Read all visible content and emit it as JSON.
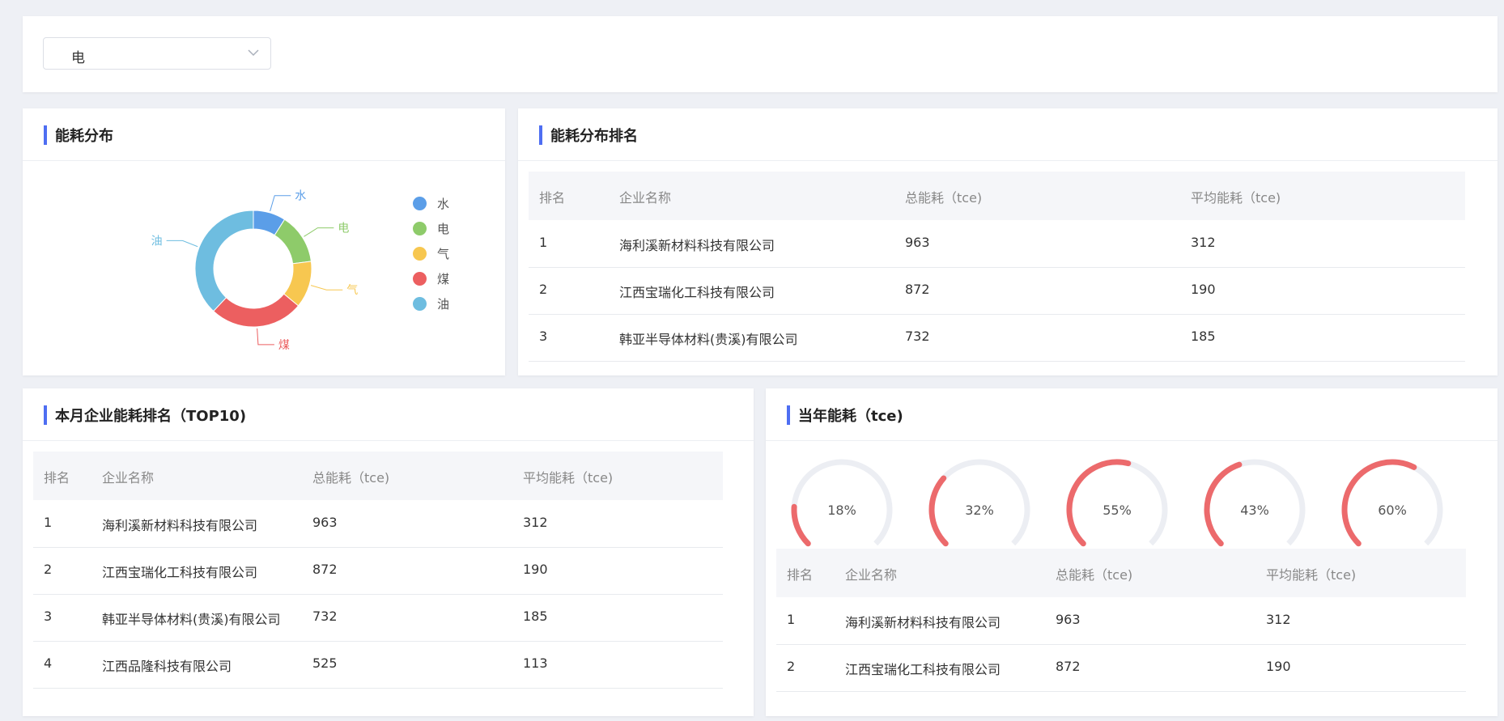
{
  "filter": {
    "selected": "电"
  },
  "distribution": {
    "title": "能耗分布",
    "colors": {
      "水": "#5b9ee8",
      "电": "#8ecb6a",
      "气": "#f7c750",
      "煤": "#ec5f60",
      "油": "#6ebde0"
    },
    "legend": [
      {
        "label": "水",
        "color": "#5b9ee8"
      },
      {
        "label": "电",
        "color": "#8ecb6a"
      },
      {
        "label": "气",
        "color": "#f7c750"
      },
      {
        "label": "煤",
        "color": "#ec5f60"
      },
      {
        "label": "油",
        "color": "#6ebde0"
      }
    ],
    "chart_data": {
      "type": "pie",
      "categories": [
        "水",
        "电",
        "气",
        "煤",
        "油"
      ],
      "values": [
        9,
        14,
        13,
        26,
        38
      ]
    }
  },
  "ranking": {
    "title": "能耗分布排名",
    "headers": [
      "排名",
      "企业名称",
      "总能耗（tce)",
      "平均能耗（tce)"
    ],
    "rows": [
      [
        "1",
        "海利溪新材料科技有限公司",
        "963",
        "312"
      ],
      [
        "2",
        "江西宝瑞化工科技有限公司",
        "872",
        "190"
      ],
      [
        "3",
        "韩亚半导体材料(贵溪)有限公司",
        "732",
        "185"
      ]
    ]
  },
  "month": {
    "title": "本月企业能耗排名（TOP10)",
    "headers": [
      "排名",
      "企业名称",
      "总能耗（tce)",
      "平均能耗（tce)"
    ],
    "rows": [
      [
        "1",
        "海利溪新材料科技有限公司",
        "963",
        "312"
      ],
      [
        "2",
        "江西宝瑞化工科技有限公司",
        "872",
        "190"
      ],
      [
        "3",
        "韩亚半导体材料(贵溪)有限公司",
        "732",
        "185"
      ],
      [
        "4",
        "江西品隆科技有限公司",
        "525",
        "113"
      ]
    ]
  },
  "year": {
    "title": "当年能耗（tce)",
    "gauge_color": "#ec6a6c",
    "gauge_track": "#eceef3",
    "gauges": [
      {
        "label": "18%",
        "value": 0.18
      },
      {
        "label": "32%",
        "value": 0.32
      },
      {
        "label": "55%",
        "value": 0.55
      },
      {
        "label": "43%",
        "value": 0.43
      },
      {
        "label": "60%",
        "value": 0.6
      }
    ],
    "headers": [
      "排名",
      "企业名称",
      "总能耗（tce)",
      "平均能耗（tce)"
    ],
    "rows": [
      [
        "1",
        "海利溪新材料科技有限公司",
        "963",
        "312"
      ],
      [
        "2",
        "江西宝瑞化工科技有限公司",
        "872",
        "190"
      ]
    ]
  }
}
